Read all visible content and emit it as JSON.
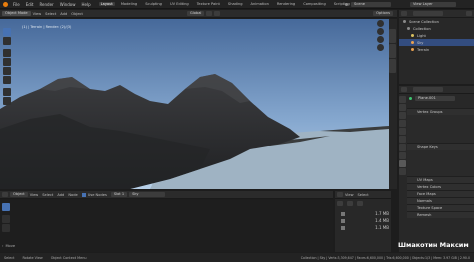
{
  "topbar": {
    "menus": [
      "File",
      "Edit",
      "Render",
      "Window",
      "Help"
    ],
    "workspaces": [
      "Layout",
      "Modeling",
      "Sculpting",
      "UV Editing",
      "Texture Paint",
      "Shading",
      "Animation",
      "Rendering",
      "Compositing",
      "Scripting"
    ],
    "active_workspace": "Layout",
    "scene_label": "Scene",
    "view_layer_label": "View Layer"
  },
  "viewport": {
    "mode": "Object Mode",
    "menu": [
      "View",
      "Select",
      "Add",
      "Object"
    ],
    "orientation": "Global",
    "options": "Options",
    "overlay_text": "(1) | Terrain | Render: (2)/(3)"
  },
  "outliner": {
    "title": "Scene Collection",
    "items": [
      "Collection",
      "Light",
      "Sky",
      "Terrain"
    ],
    "selected": "Sky"
  },
  "properties": {
    "object_name": "Plane.001",
    "sections": [
      "Vertex Groups",
      "Shape Keys",
      "UV Maps",
      "Vertex Colors",
      "Face Maps",
      "Normals",
      "Texture Space",
      "Remesh"
    ]
  },
  "node_editor": {
    "editor_label": "Object",
    "menu": [
      "View",
      "Select",
      "Add",
      "Node"
    ],
    "use_nodes": "Use Nodes",
    "slot": "Slot 1",
    "material": "Sky"
  },
  "file_browser": {
    "header": [
      "View",
      "Select"
    ],
    "entries": [
      {
        "name": "",
        "size": "1.7 MB"
      },
      {
        "name": "",
        "size": "1.4 MB"
      },
      {
        "name": "",
        "size": "1.1 MB"
      }
    ]
  },
  "left_panel": {
    "label": "Move"
  },
  "status": {
    "left": [
      "Select",
      "Rotate View",
      "Object Context Menu"
    ],
    "right": "Collection | Sky | Verts:3,309,647 | Faces:6,600,000 | Tris:6,600,000 | Objects:1/3 | Mem: 3.97 GiB | 2.90.0"
  },
  "watermark": "Шмакотин Максим",
  "colors": {
    "accent": "#4772b3",
    "sky_top": "#4a6f9c",
    "sky_bottom": "#a9c7e6",
    "water": "#9fb6c9",
    "rock": "#2e2f31"
  }
}
